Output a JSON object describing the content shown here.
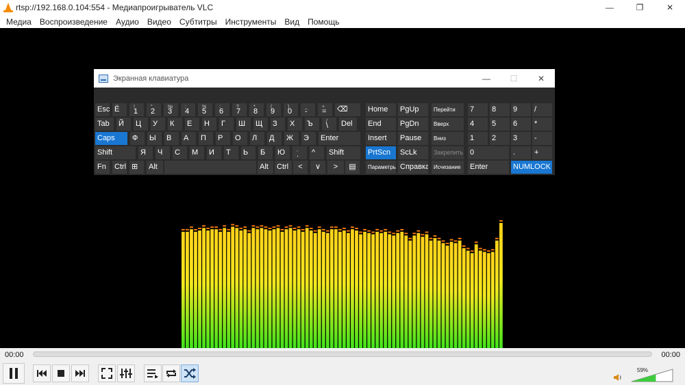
{
  "window": {
    "title": "rtsp://192.168.0.104:554 - Медиапроигрыватель VLC",
    "minimize": "—",
    "maximize": "❐",
    "close": "✕"
  },
  "menu": [
    "Медиа",
    "Воспроизведение",
    "Аудио",
    "Видео",
    "Субтитры",
    "Инструменты",
    "Вид",
    "Помощь"
  ],
  "osk": {
    "title": "Экранная клавиатура",
    "minimize": "—",
    "maximize": "☐",
    "close": "✕",
    "row1": [
      {
        "label": "Esc"
      },
      {
        "label": "Ё"
      },
      {
        "label": "1",
        "sub": "!"
      },
      {
        "label": "2",
        "sub": "\""
      },
      {
        "label": "3",
        "sub": "№"
      },
      {
        "label": "4",
        "sub": ";"
      },
      {
        "label": "5",
        "sub": "%"
      },
      {
        "label": "6",
        "sub": ":"
      },
      {
        "label": "7",
        "sub": "?"
      },
      {
        "label": "8",
        "sub": "*"
      },
      {
        "label": "9",
        "sub": "("
      },
      {
        "label": "0",
        "sub": ")"
      },
      {
        "label": "-",
        "sub": "_"
      },
      {
        "label": "=",
        "sub": "+"
      },
      {
        "label": "⌫"
      }
    ],
    "row2": [
      "Tab",
      "Й",
      "Ц",
      "У",
      "К",
      "Е",
      "Н",
      "Г",
      "Ш",
      "Щ",
      "З",
      "Х",
      "Ъ",
      "\\",
      "Del"
    ],
    "row2_sub": "/",
    "row3": [
      "Caps",
      "Ф",
      "Ы",
      "В",
      "А",
      "П",
      "Р",
      "О",
      "Л",
      "Д",
      "Ж",
      "Э",
      "Enter"
    ],
    "row4": [
      "Shift",
      "Я",
      "Ч",
      "С",
      "М",
      "И",
      "Т",
      "Ь",
      "Б",
      "Ю",
      ".",
      "^",
      "Shift"
    ],
    "row4_sub": ",",
    "row5": [
      "Fn",
      "Ctrl",
      "⊞",
      "Alt",
      "",
      "Alt",
      "Ctrl",
      "<",
      "∨",
      ">",
      "▤"
    ],
    "nav": [
      [
        "Home",
        "PgUp",
        "Перейти"
      ],
      [
        "End",
        "PgDn",
        "Вверх"
      ],
      [
        "Insert",
        "Pause",
        "Вниз"
      ],
      [
        "PrtScn",
        "ScLk",
        "Закрепить"
      ],
      [
        "Параметры",
        "Справка",
        "Исчезание"
      ]
    ],
    "numpad": [
      [
        "7",
        "8",
        "9",
        "/"
      ],
      [
        "4",
        "5",
        "6",
        "*"
      ],
      [
        "1",
        "2",
        "3",
        "-"
      ],
      [
        "0",
        ".",
        "+"
      ],
      [
        "Enter",
        "NUMLOCK"
      ]
    ]
  },
  "spectrum": {
    "colors": {
      "top": "#ffd21a",
      "mid": "#f2e81e",
      "bottom": "#3fe21c",
      "peak": "#f37a10"
    },
    "levels": [
      0.93,
      0.93,
      0.95,
      0.93,
      0.94,
      0.96,
      0.94,
      0.95,
      0.95,
      0.93,
      0.96,
      0.93,
      0.97,
      0.96,
      0.94,
      0.95,
      0.92,
      0.96,
      0.95,
      0.96,
      0.95,
      0.94,
      0.95,
      0.96,
      0.93,
      0.95,
      0.96,
      0.94,
      0.95,
      0.93,
      0.96,
      0.94,
      0.92,
      0.95,
      0.93,
      0.92,
      0.95,
      0.95,
      0.93,
      0.94,
      0.92,
      0.95,
      0.94,
      0.91,
      0.93,
      0.92,
      0.91,
      0.93,
      0.92,
      0.93,
      0.91,
      0.9,
      0.92,
      0.93,
      0.9,
      0.86,
      0.9,
      0.92,
      0.89,
      0.91,
      0.86,
      0.88,
      0.86,
      0.84,
      0.82,
      0.85,
      0.84,
      0.86,
      0.8,
      0.78,
      0.76,
      0.83,
      0.78,
      0.77,
      0.76,
      0.77,
      0.86,
      1.0
    ]
  },
  "player": {
    "time_elapsed": "00:00",
    "time_total": "00:00",
    "volume_percent": "59%",
    "volume_level": 0.59,
    "buttons": {
      "pause": "pause-icon",
      "previous": "previous-icon",
      "stop": "stop-icon",
      "next": "next-icon",
      "fullscreen": "fullscreen-icon",
      "extended": "equalizer-icon",
      "playlist": "playlist-icon",
      "loop": "loop-icon",
      "random": "shuffle-icon"
    }
  }
}
